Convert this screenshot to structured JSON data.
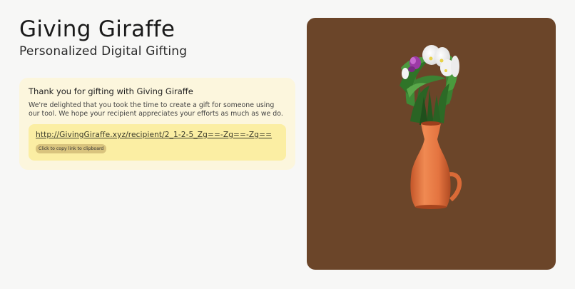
{
  "header": {
    "title": "Giving Giraffe",
    "subtitle": "Personalized Digital Gifting"
  },
  "card": {
    "title": "Thank you for gifting with Giving Giraffe",
    "body": "We're delighted that you took the time to create a gift for someone using our tool. We hope your recipient appreciates your efforts as much as we do.",
    "link": "http://GivingGiraffe.xyz/recipient/2_1-2-5_Zg==-Zg==-Zg==",
    "copy_label": "Click to copy link to clipboard"
  },
  "viewer": {
    "background": "#6b4529",
    "vase_color": "#e0733f"
  }
}
